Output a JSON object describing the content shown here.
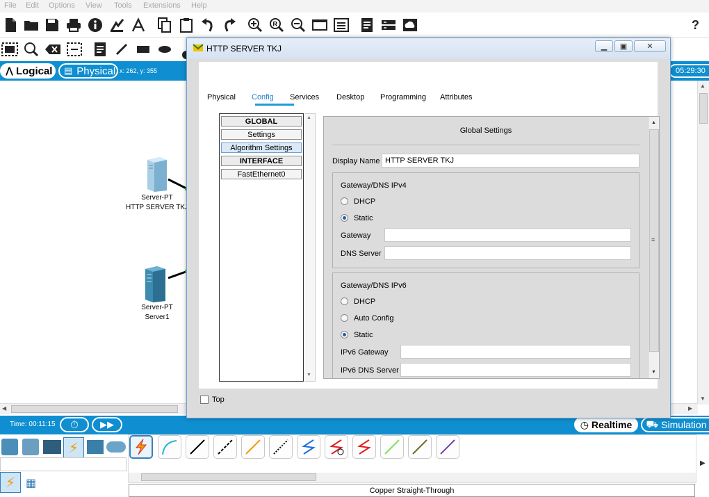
{
  "menu": [
    "File",
    "Edit",
    "Options",
    "View",
    "Tools",
    "Extensions",
    "Help"
  ],
  "nav": {
    "logical_label": "Logical",
    "physical_label": "Physical",
    "coords": "x: 262, y: 355",
    "clock": "05:29:30"
  },
  "help_icon": "?",
  "devices": [
    {
      "type": "Server-PT",
      "name": "HTTP SERVER TKJ"
    },
    {
      "type": "Server-PT",
      "name": "Server1"
    }
  ],
  "dialog": {
    "title": "HTTP SERVER TKJ",
    "tabs": [
      "Physical",
      "Config",
      "Services",
      "Desktop",
      "Programming",
      "Attributes"
    ],
    "active_tab": "Config",
    "left_list": {
      "global_header": "GLOBAL",
      "settings": "Settings",
      "algorithm_settings": "Algorithm Settings",
      "interface_header": "INTERFACE",
      "fastethernet": "FastEthernet0"
    },
    "global_settings": {
      "title": "Global Settings",
      "display_name_label": "Display Name",
      "display_name_value": "HTTP SERVER TKJ",
      "ipv4": {
        "title": "Gateway/DNS IPv4",
        "dhcp": "DHCP",
        "static": "Static",
        "gateway_label": "Gateway",
        "gateway_value": "",
        "dns_label": "DNS Server",
        "dns_value": ""
      },
      "ipv6": {
        "title": "Gateway/DNS IPv6",
        "dhcp": "DHCP",
        "auto_config": "Auto Config",
        "static": "Static",
        "gateway_label": "IPv6 Gateway",
        "gateway_value": "",
        "dns_label": "IPv6 DNS Server",
        "dns_value": ""
      }
    },
    "top_label": "Top"
  },
  "bottom": {
    "time": "Time: 00:11:15",
    "realtime": "Realtime",
    "simulation": "Simulation",
    "cable_name": "Copper Straight-Through"
  },
  "colors": {
    "accent_blue": "#0f8fd1",
    "config_tab": "#1f7fd4"
  }
}
